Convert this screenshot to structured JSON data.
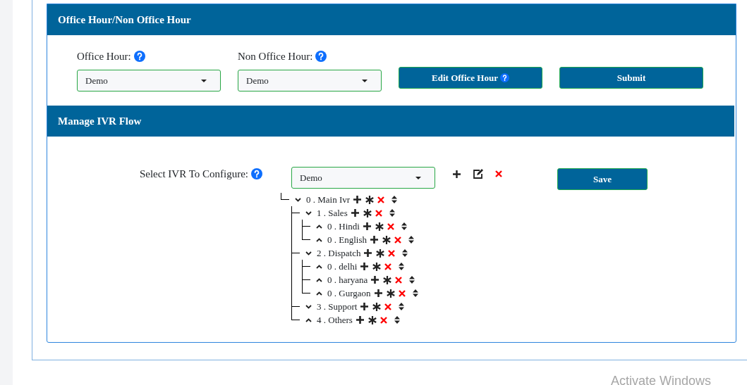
{
  "office_panel": {
    "title": "Office Hour/Non Office Hour",
    "fields": [
      {
        "label": "Office Hour:",
        "value": "Demo"
      },
      {
        "label": "Non Office Hour:",
        "value": "Demo"
      }
    ],
    "buttons": [
      {
        "label": "Edit Office Hour",
        "help": true
      },
      {
        "label": "Submit",
        "help": false
      }
    ]
  },
  "ivr_panel": {
    "title": "Manage IVR Flow",
    "select_label": "Select IVR To Configure:",
    "select_value": "Demo",
    "save_button": "Save",
    "tree": [
      {
        "text": "0 . Main Ivr",
        "expanded": true,
        "children": [
          {
            "text": "1 . Sales",
            "expanded": true,
            "children": [
              {
                "text": "0 . Hindi",
                "expanded": false
              },
              {
                "text": "0 . English",
                "expanded": false
              }
            ]
          },
          {
            "text": "2 . Dispatch",
            "expanded": true,
            "children": [
              {
                "text": "0 . delhi",
                "expanded": false
              },
              {
                "text": "0 . haryana",
                "expanded": false
              },
              {
                "text": "0 . Gurgaon",
                "expanded": false
              }
            ]
          },
          {
            "text": "3 . Support",
            "expanded": true
          },
          {
            "text": "4 . Others",
            "expanded": false
          }
        ]
      }
    ]
  },
  "os_notice": "Activate Windows"
}
